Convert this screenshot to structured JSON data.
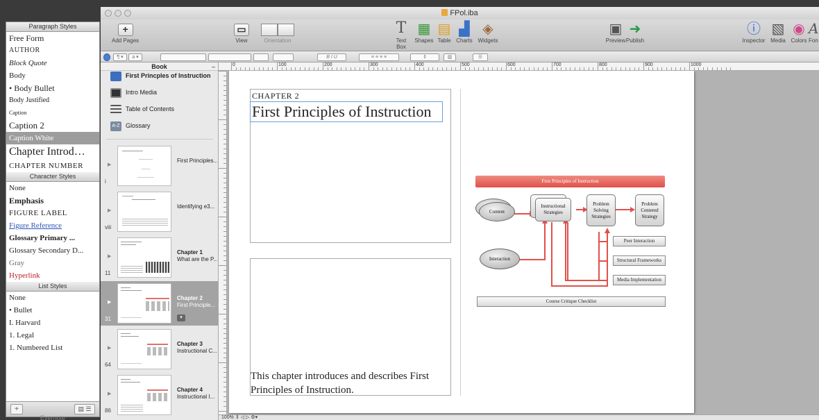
{
  "window": {
    "title": "FPol.iba"
  },
  "toolbar": {
    "add_pages": "Add Pages",
    "view": "View",
    "orientation": "Orientation",
    "text_box": "Text Box",
    "shapes": "Shapes",
    "table": "Table",
    "charts": "Charts",
    "widgets": "Widgets",
    "preview": "Preview",
    "publish": "Publish",
    "inspector": "Inspector",
    "media": "Media",
    "colors": "Colors",
    "fonts": "Fon"
  },
  "styles_panel": {
    "paragraph_header": "Paragraph Styles",
    "paragraph_styles": [
      "Free Form",
      "AUTHOR",
      "Block Quote",
      "Body",
      "• Body Bullet",
      "Body Justified",
      "Caption",
      "Caption 2",
      "Caption White",
      "Chapter Introd…",
      "CHAPTER NUMBER"
    ],
    "character_header": "Character Styles",
    "character_styles": [
      "None",
      "Emphasis",
      "FIGURE LABEL",
      "Figure Reference",
      "Glossary Primary ...",
      "Glossary Secondary D...",
      "Gray",
      "Hyperlink"
    ],
    "list_header": "List Styles",
    "list_styles": [
      "None",
      "• Bullet",
      "I. Harvard",
      "1. Legal",
      "1. Numbered List"
    ],
    "footer_label": "Evernote"
  },
  "book": {
    "header": "Book",
    "items": [
      {
        "label": "First Princples of Instruction",
        "icon": "book-icon"
      },
      {
        "label": "Intro Media",
        "icon": "film-icon"
      },
      {
        "label": "Table of Contents",
        "icon": "list-icon"
      },
      {
        "label": "Glossary",
        "icon": "az-icon"
      }
    ],
    "pages": [
      {
        "num": "i",
        "title": "First Principles...",
        "subtitle": ""
      },
      {
        "num": "viii",
        "title": "Identifying e3...",
        "subtitle": ""
      },
      {
        "num": "11",
        "title": "Chapter 1",
        "subtitle": "What are the P..."
      },
      {
        "num": "31",
        "title": "Chapter 2",
        "subtitle": "First Principle..."
      },
      {
        "num": "64",
        "title": "Chapter 3",
        "subtitle": "Instructional C..."
      },
      {
        "num": "86",
        "title": "Chapter 4",
        "subtitle": "Instructional I..."
      }
    ]
  },
  "ruler": {
    "h_labels": [
      "0",
      "100",
      "200",
      "300",
      "400",
      "500",
      "600",
      "700",
      "800",
      "900",
      "1000"
    ]
  },
  "page": {
    "chapter_number": "CHAPTER 2",
    "chapter_title": "First Principles of Instruction",
    "intro_text": "This chapter introduces and describes First Principles of Instruction."
  },
  "diagram": {
    "title": "First Principles of Instruction",
    "content": "Content",
    "instructional_strategies": "Instructional Strategies",
    "problem_solving": "Problem Solving Strategies",
    "problem_centered": "Problem Centered Strategy",
    "interaction": "Interaction",
    "peer_interaction": "Peer Interaction",
    "structural_frameworks": "Structural Frameworks",
    "media_implementation": "Media Implementation",
    "course_critique": "Course Critique Checklist",
    "accent_color": "#e0514a"
  },
  "status": {
    "zoom": "100%"
  }
}
